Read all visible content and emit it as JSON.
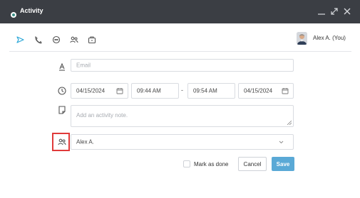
{
  "window": {
    "title": "Activity"
  },
  "colors": {
    "titlebar": "#3b3e44",
    "accent": "#2aa7d8",
    "save_button": "#5aa9d6",
    "highlight": "#e03a3a"
  },
  "tabs": [
    {
      "icon": "send-icon",
      "active": true
    },
    {
      "icon": "phone-icon",
      "active": false
    },
    {
      "icon": "chat-icon",
      "active": false
    },
    {
      "icon": "people-icon",
      "active": false
    },
    {
      "icon": "briefcase-icon",
      "active": false
    }
  ],
  "user": {
    "name": "Alex A. (You)"
  },
  "form": {
    "email": {
      "placeholder": "Email",
      "value": ""
    },
    "start_date": "04/15/2024",
    "start_time": "09:44 AM",
    "separator": "-",
    "end_time": "09:54 AM",
    "end_date": "04/15/2024",
    "note": {
      "placeholder": "Add an activity note.",
      "value": ""
    },
    "assignee": "Alex A."
  },
  "footer": {
    "mark_done_label": "Mark as done",
    "mark_done_checked": false,
    "cancel_label": "Cancel",
    "save_label": "Save"
  }
}
